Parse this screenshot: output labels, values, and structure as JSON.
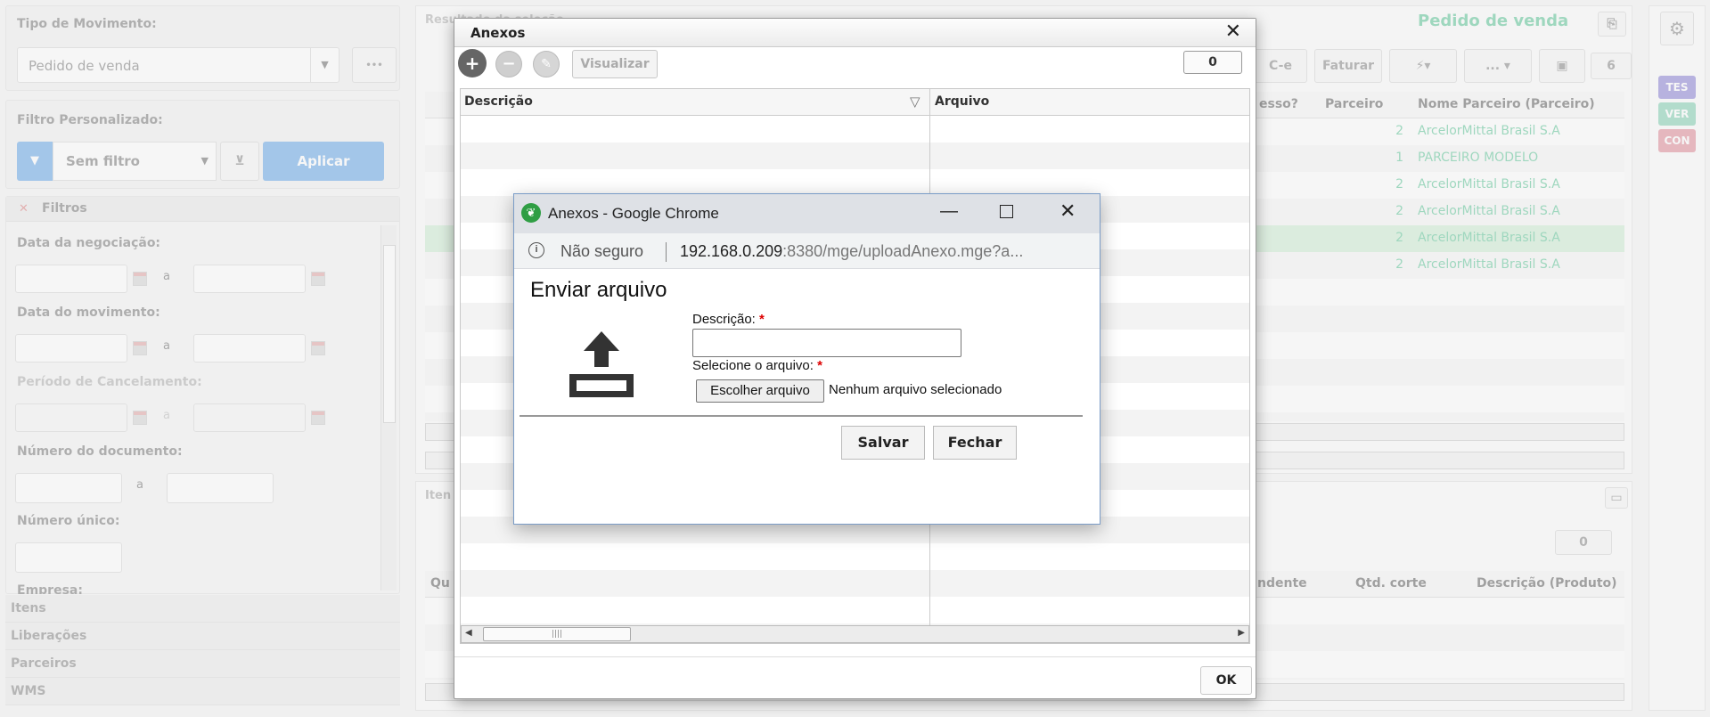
{
  "left": {
    "tipo_label": "Tipo de Movimento:",
    "tipo_value": "Pedido de venda",
    "tipo_more": "•••",
    "filtro_label": "Filtro Personalizado:",
    "filtro_value": "Sem filtro",
    "aplicar": "Aplicar",
    "filtros_title": "Filtros",
    "fields": {
      "data_neg": "Data da negociação:",
      "data_mov": "Data do movimento:",
      "periodo_canc": "Período de Cancelamento:",
      "num_doc": "Número do documento:",
      "num_unico": "Número único:",
      "empresa": "Empresa:"
    },
    "range_sep": "a",
    "accordion": [
      "Itens",
      "Liberações",
      "Parceiros",
      "WMS"
    ]
  },
  "right": {
    "title_partial": "Resultado da seleção",
    "module_title": "Pedido de venda",
    "buttons": {
      "cte": "C-e",
      "faturar": "Faturar",
      "more": "...",
      "count": "6"
    },
    "columns": [
      "esso?",
      "Parceiro",
      "Nome Parceiro (Parceiro)"
    ],
    "rows": [
      {
        "parc": "2",
        "nome": "ArcelorMittal Brasil S.A",
        "sel": false
      },
      {
        "parc": "1",
        "nome": "PARCEIRO MODELO",
        "sel": false
      },
      {
        "parc": "2",
        "nome": "ArcelorMittal Brasil S.A",
        "sel": false
      },
      {
        "parc": "2",
        "nome": "ArcelorMittal Brasil S.A",
        "sel": false
      },
      {
        "parc": "2",
        "nome": "ArcelorMittal Brasil S.A",
        "sel": true
      },
      {
        "parc": "2",
        "nome": "ArcelorMittal Brasil S.A",
        "sel": false
      }
    ],
    "items_partial": "Iten",
    "items_count": "0",
    "items_columns": [
      "Qu",
      "ndente",
      "Qtd. corte",
      "Descrição (Produto)"
    ],
    "side_tags": [
      {
        "label": "TES",
        "color": "#6a5ec9"
      },
      {
        "label": "VER",
        "color": "#5fc29c"
      },
      {
        "label": "CON",
        "color": "#d86a7a"
      }
    ]
  },
  "anexos": {
    "title": "Anexos",
    "visualizar": "Visualizar",
    "count": "0",
    "col_descricao": "Descrição",
    "col_arquivo": "Arquivo",
    "ok": "OK"
  },
  "chrome": {
    "title": "Anexos - Google Chrome",
    "security": "Não seguro",
    "url_host": "192.168.0.209",
    "url_rest": ":8380/mge/uploadAnexo.mge?a...",
    "heading": "Enviar arquivo",
    "descricao_label": "Descrição:",
    "arquivo_label": "Selecione o arquivo:",
    "required": "*",
    "choose_btn": "Escolher arquivo",
    "no_file": "Nenhum arquivo selecionado",
    "salvar": "Salvar",
    "fechar": "Fechar"
  }
}
